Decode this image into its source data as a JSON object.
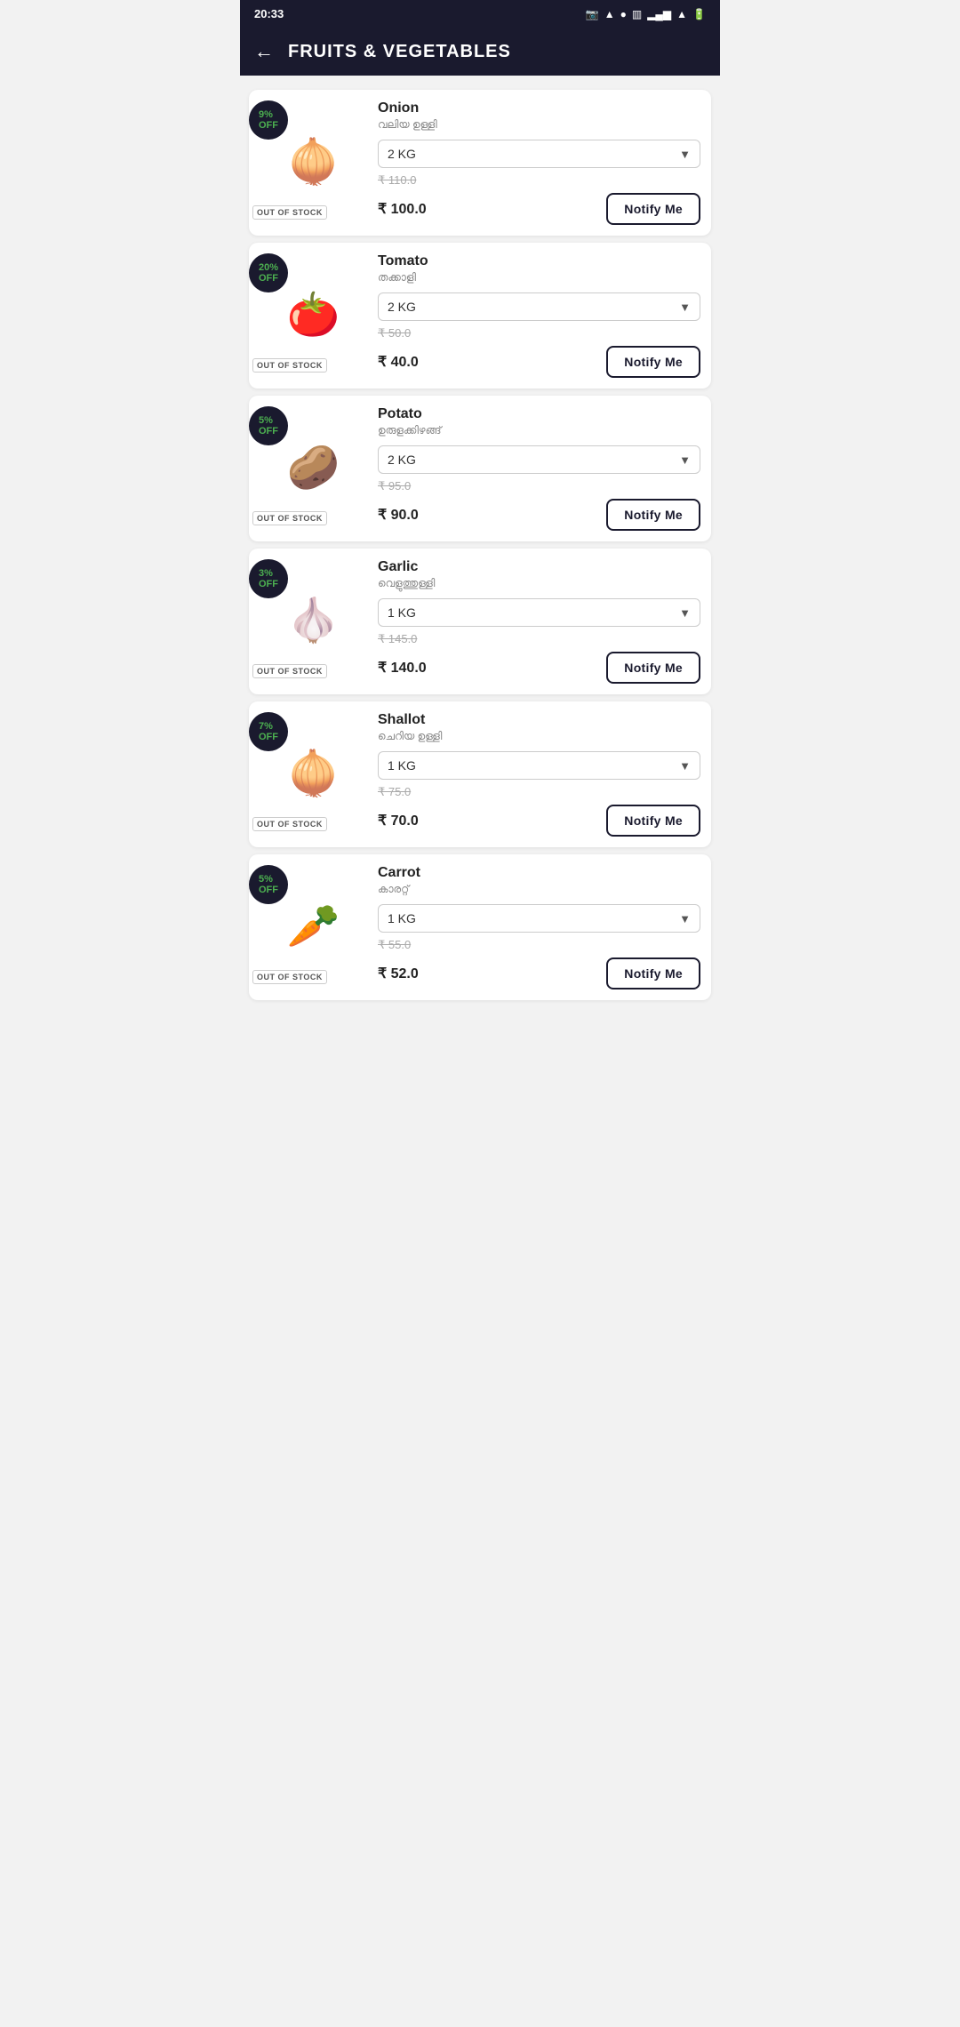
{
  "statusBar": {
    "time": "20:33",
    "icons": "📷 ▲ ◆"
  },
  "header": {
    "backLabel": "←",
    "title": "FRUITS & VEGETABLES"
  },
  "products": [
    {
      "id": "onion",
      "name": "Onion",
      "nameLocal": "വലിയ ഉള്ളി",
      "discount": "9%\nOFF",
      "outOfStock": "OUT OF STOCK",
      "quantity": "2 KG",
      "priceOriginal": "₹ 110.0",
      "priceCurrent": "₹ 100.0",
      "notifyLabel": "Notify Me",
      "emoji": "🧅"
    },
    {
      "id": "tomato",
      "name": "Tomato",
      "nameLocal": "തക്കാളി",
      "discount": "20%\nOFF",
      "outOfStock": "OUT OF STOCK",
      "quantity": "2 KG",
      "priceOriginal": "₹ 50.0",
      "priceCurrent": "₹ 40.0",
      "notifyLabel": "Notify Me",
      "emoji": "🍅"
    },
    {
      "id": "potato",
      "name": "Potato",
      "nameLocal": "ഉരുളക്കിഴങ്ങ്",
      "discount": "5%\nOFF",
      "outOfStock": "OUT OF STOCK",
      "quantity": "2 KG",
      "priceOriginal": "₹ 95.0",
      "priceCurrent": "₹ 90.0",
      "notifyLabel": "Notify Me",
      "emoji": "🥔"
    },
    {
      "id": "garlic",
      "name": "Garlic",
      "nameLocal": "വെളുത്തുള്ളി",
      "discount": "3%\nOFF",
      "outOfStock": "OUT OF STOCK",
      "quantity": "1 KG",
      "priceOriginal": "₹ 145.0",
      "priceCurrent": "₹ 140.0",
      "notifyLabel": "Notify Me",
      "emoji": "🧄"
    },
    {
      "id": "shallot",
      "name": "Shallot",
      "nameLocal": "ചെറിയ ഉള്ളി",
      "discount": "7%\nOFF",
      "outOfStock": "OUT OF STOCK",
      "quantity": "1 KG",
      "priceOriginal": "₹ 75.0",
      "priceCurrent": "₹ 70.0",
      "notifyLabel": "Notify Me",
      "emoji": "🧅"
    },
    {
      "id": "carrot",
      "name": "Carrot",
      "nameLocal": "കാരറ്റ്",
      "discount": "5%\nOFF",
      "outOfStock": "OUT OF STOCK",
      "quantity": "1 KG",
      "priceOriginal": "₹ 55.0",
      "priceCurrent": "₹ 52.0",
      "notifyLabel": "Notify Me",
      "emoji": "🥕"
    }
  ]
}
